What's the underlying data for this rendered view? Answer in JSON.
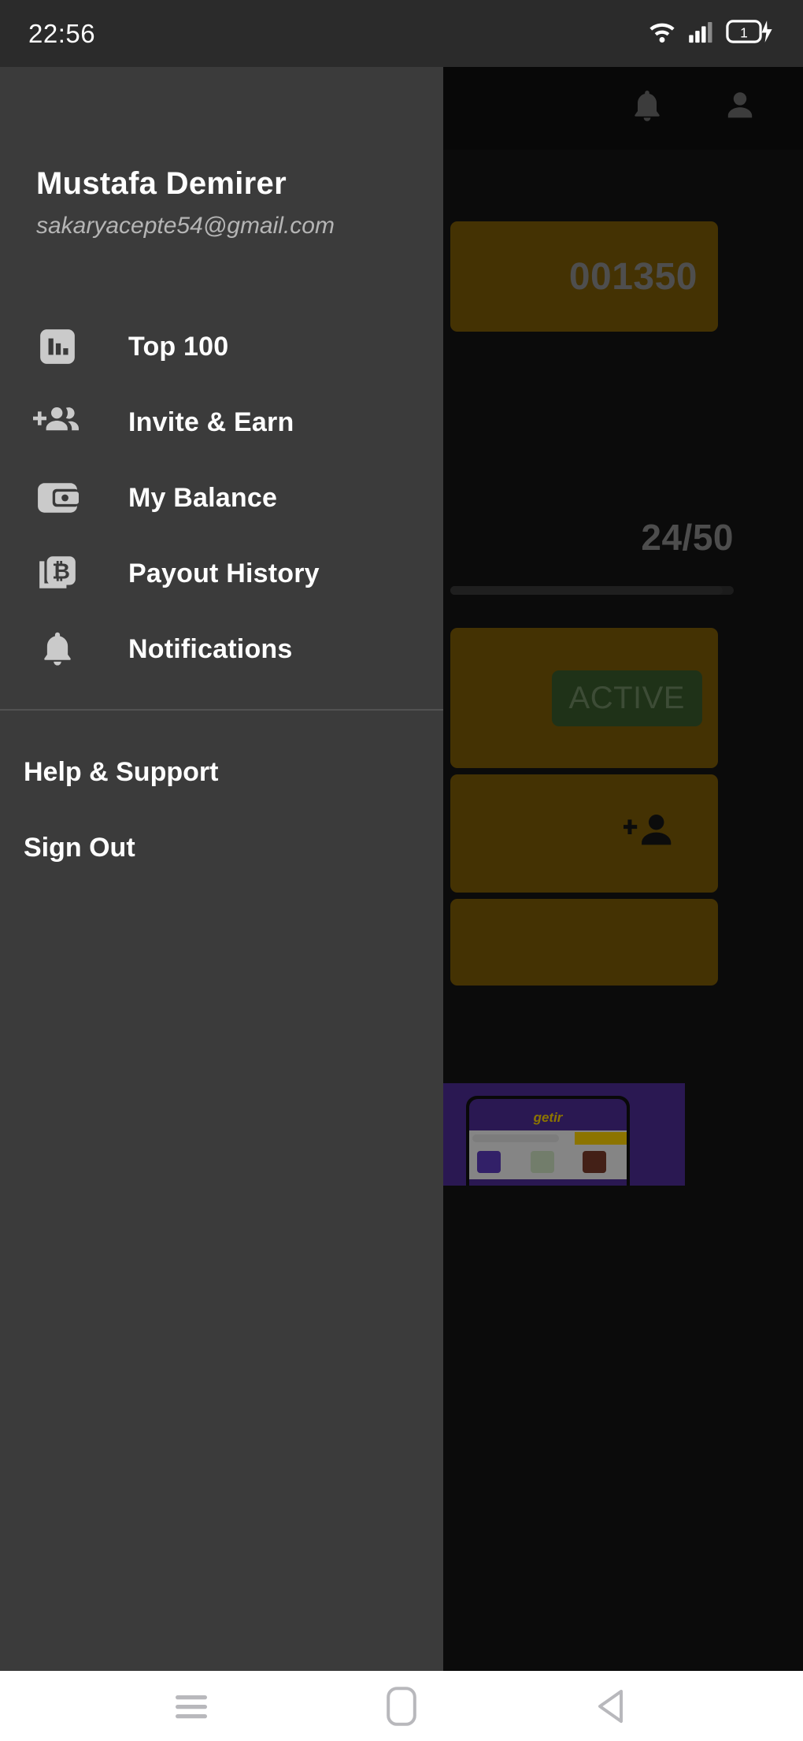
{
  "status_bar": {
    "time": "22:56",
    "icons": [
      "wifi-icon",
      "cellular-signal-icon",
      "battery-icon"
    ],
    "battery_level_label": "1",
    "charging": true,
    "background_color": "#2b2b2b"
  },
  "app_bar": {
    "icons": [
      "notifications-bell-icon",
      "profile-person-icon"
    ],
    "background_color": "#101010"
  },
  "background_app": {
    "balance_card": {
      "amount": "001350",
      "color": "#7d5c06"
    },
    "progress": {
      "value_label": "24/50",
      "current": 24,
      "total": 50
    },
    "status_card": {
      "badge_label": "ACTIVE",
      "badge_color": "#3a5c2d"
    },
    "invite_card": {
      "icon": "person-add-icon",
      "color": "#7d5c06"
    },
    "third_card": {
      "color": "#7d5c06"
    },
    "advertisement": {
      "brand_label": "getir",
      "background_color": "#4d2d95",
      "logo_color": "#ffd400"
    }
  },
  "drawer": {
    "background_color": "#3b3b3b",
    "user": {
      "name": "Mustafa Demirer",
      "email": "sakaryacepte54@gmail.com"
    },
    "menu_items": [
      {
        "label": "Top 100",
        "icon": "bar-chart-icon"
      },
      {
        "label": "Invite & Earn",
        "icon": "person-add-group-icon"
      },
      {
        "label": "My Balance",
        "icon": "wallet-icon"
      },
      {
        "label": "Payout History",
        "icon": "bitcoin-cards-icon"
      },
      {
        "label": "Notifications",
        "icon": "bell-icon"
      }
    ],
    "footer_items": [
      {
        "label": "Help & Support"
      },
      {
        "label": "Sign Out"
      }
    ]
  },
  "bottom_nav": {
    "background_color": "#ffffff",
    "buttons": [
      {
        "name": "recents-button",
        "icon": "hamburger-recents-icon"
      },
      {
        "name": "home-button",
        "icon": "home-square-icon"
      },
      {
        "name": "back-button",
        "icon": "back-triangle-icon"
      }
    ]
  }
}
